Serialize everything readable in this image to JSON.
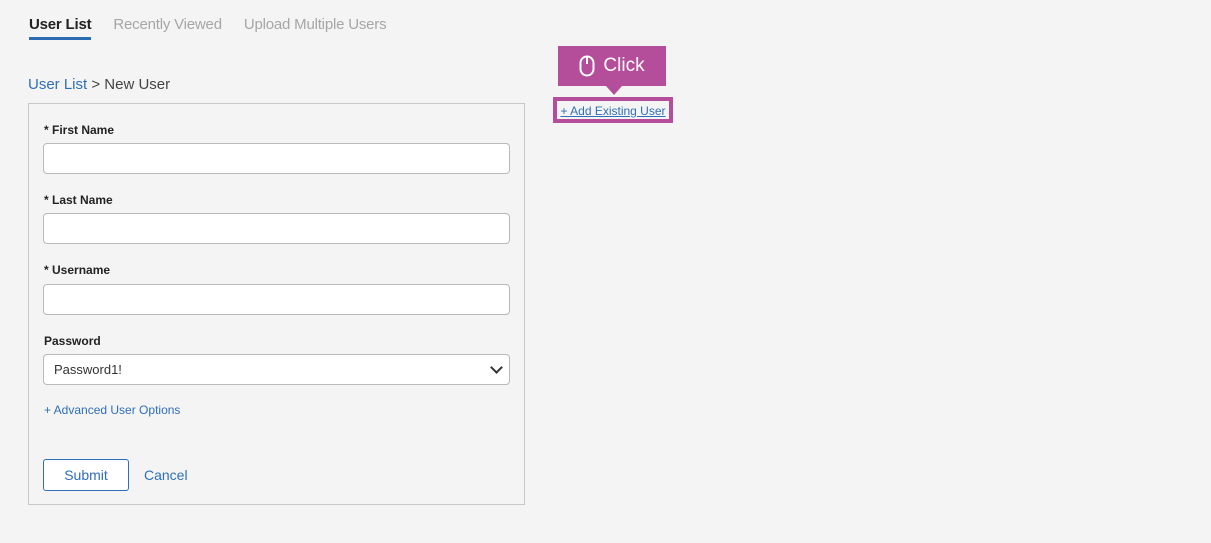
{
  "tabs": [
    {
      "label": "User List",
      "active": true
    },
    {
      "label": "Recently Viewed",
      "active": false
    },
    {
      "label": "Upload Multiple Users",
      "active": false
    }
  ],
  "breadcrumb": {
    "root": "User List",
    "separator": ">",
    "current": "New User"
  },
  "form": {
    "first_name_label": "* First Name",
    "first_name_value": "",
    "last_name_label": "* Last Name",
    "last_name_value": "",
    "username_label": "* Username",
    "username_value": "",
    "password_label": "Password",
    "password_selected": "Password1!",
    "advanced_link": "+ Advanced User Options",
    "submit_label": "Submit",
    "cancel_label": "Cancel"
  },
  "add_existing_link": "+ Add Existing User",
  "callout": {
    "label": "Click",
    "icon": "mouse-icon",
    "color": "#b54e9a"
  },
  "colors": {
    "accent": "#2f6fb7",
    "highlight": "#b54e9a",
    "background": "#f4f4f4"
  }
}
